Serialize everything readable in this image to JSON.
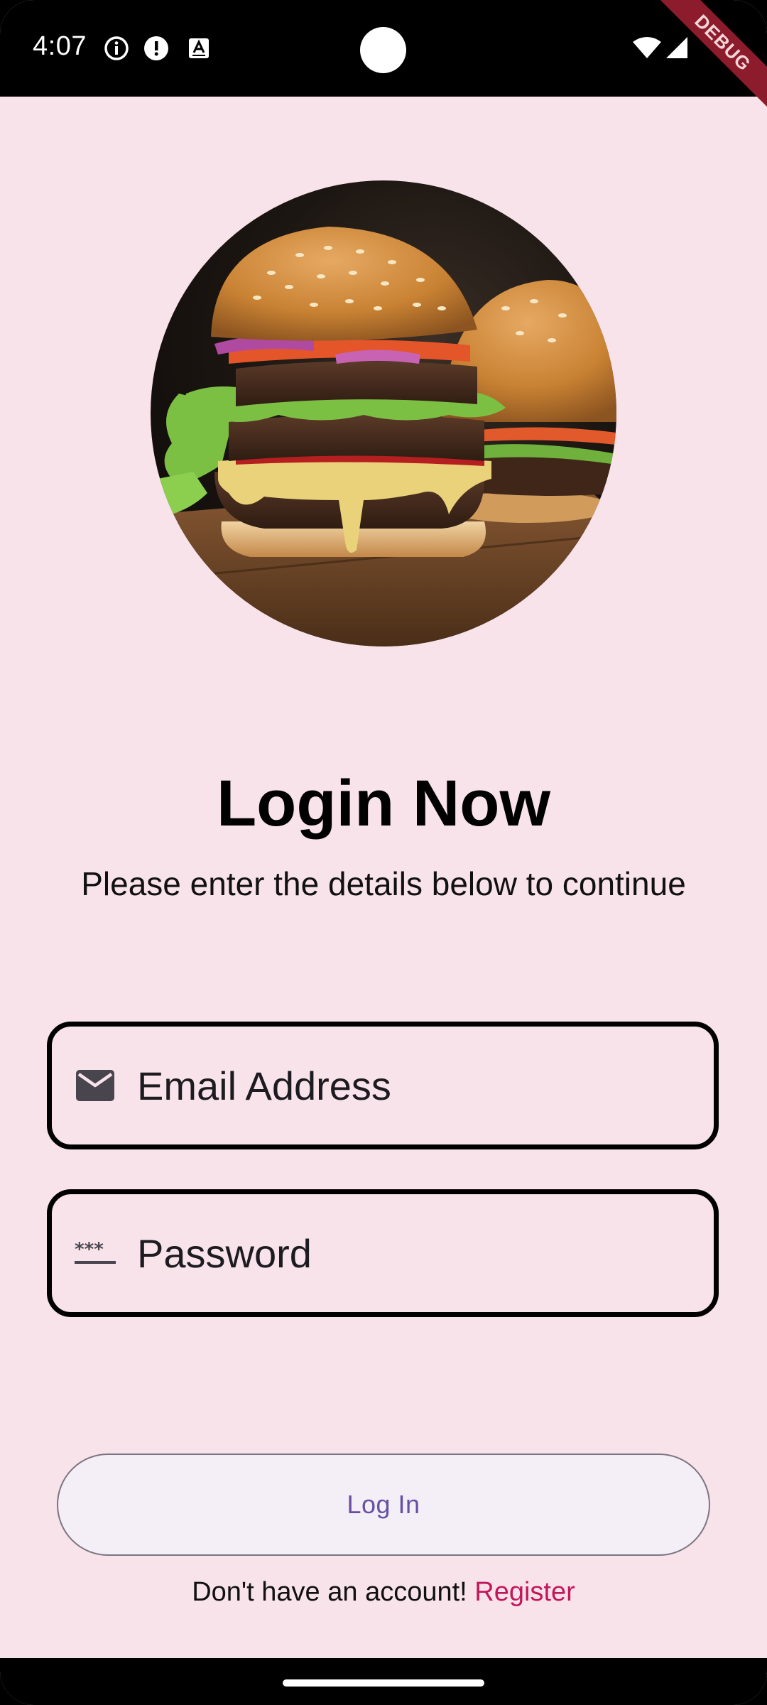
{
  "status_bar": {
    "time": "4:07",
    "left_icons": [
      "info-icon",
      "alert-icon",
      "keyboard-a-icon"
    ],
    "right_icons": [
      "wifi-icon",
      "cellular-signal-icon"
    ],
    "debug_label": "DEBUG"
  },
  "hero": {
    "image": "burger-photo"
  },
  "header": {
    "title": "Login Now",
    "subtitle": "Please enter the details below to continue"
  },
  "form": {
    "email": {
      "placeholder": "Email Address",
      "value": "",
      "icon": "mail-icon"
    },
    "password": {
      "placeholder": "Password",
      "value": "",
      "icon": "password-icon"
    }
  },
  "actions": {
    "login_label": "Log In",
    "footer_text": "Don't have an account! ",
    "register_label": "Register"
  },
  "colors": {
    "background": "#f9e3ea",
    "button_text": "#6750a4",
    "button_bg": "#f4eef6",
    "link": "#c2185b",
    "field_border": "#000000"
  }
}
